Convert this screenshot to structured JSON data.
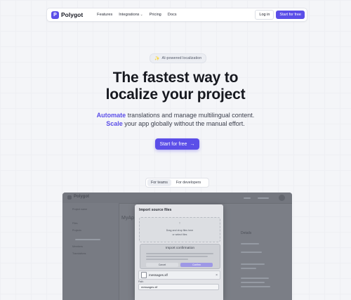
{
  "nav": {
    "logo_mark": "P",
    "logo_text": "Polygot",
    "links": [
      "Features",
      "Integrations",
      "Pricing",
      "Docs"
    ],
    "login_label": "Log in",
    "start_label": "Start for free"
  },
  "hero": {
    "badge_icon": "sparkle-icon",
    "badge": "AI-powered localization",
    "headline_line1": "The fastest way to",
    "headline_line2": "localize your project",
    "sub_accent1": "Automate",
    "sub_rest1": " translations and manage multilingual content.",
    "sub_accent2": "Scale",
    "sub_rest2": " your app globally without the manual effort.",
    "cta_label": "Start for free",
    "cta_icon": "arrow-right-icon"
  },
  "toggle": {
    "tabs": [
      "For teams",
      "For developers"
    ],
    "active": "For teams"
  },
  "preview": {
    "app_name": "Polygot",
    "project_label": "MyAp",
    "side_header": "Project name",
    "side_items": [
      "Files",
      "Projects",
      "Members",
      "Translations"
    ],
    "details_title": "Details",
    "modal": {
      "title": "Import source files",
      "drop_text": "Drag and drop files here",
      "or_text": "or",
      "browse_text": "select files",
      "confirm_title": "Import confirmation",
      "cancel_label": "Cancel",
      "confirm_label": "Confirm",
      "file_name": "messages.xlf",
      "path_label": "Path",
      "path_value": "messages.xlf"
    }
  },
  "colors": {
    "brand": "#5b4ee8",
    "background": "#f4f5f8",
    "overlay": "#7b7e86"
  }
}
